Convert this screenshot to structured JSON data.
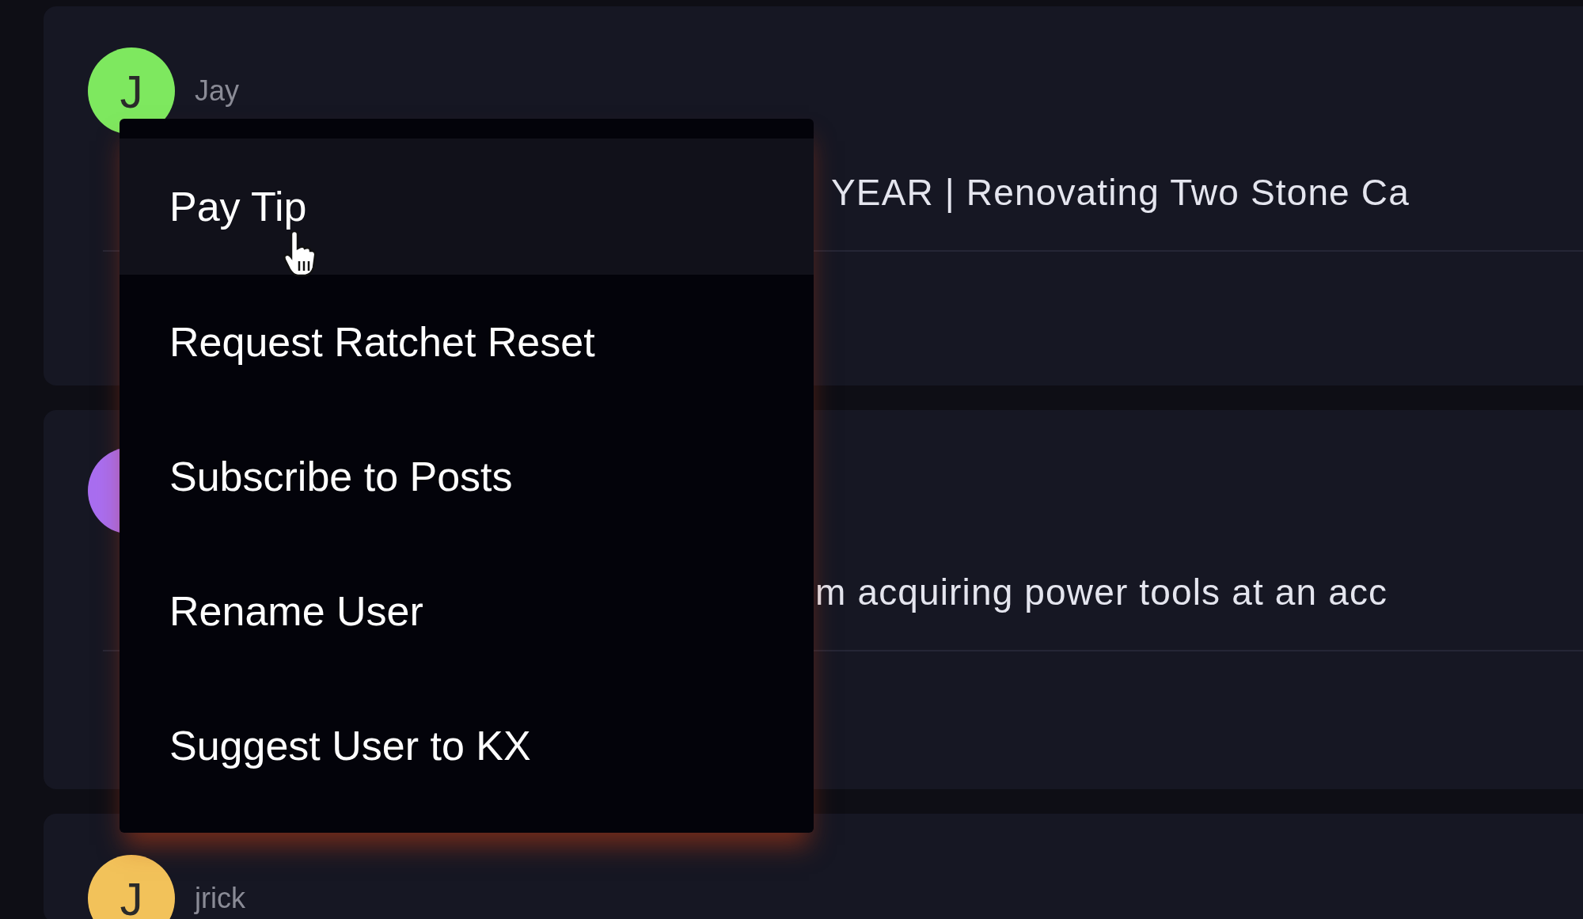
{
  "posts": [
    {
      "author": "Jay",
      "avatar_letter": "J",
      "color": "#7ee85f",
      "text": "YEAR | Renovating Two Stone Ca"
    },
    {
      "color": "#a96ef0",
      "text": "m acquiring power tools at an acc"
    },
    {
      "author": "jrick",
      "avatar_letter": "J",
      "color": "#f2c25a"
    }
  ],
  "context_menu": {
    "items": [
      {
        "label": "Pay Tip",
        "selected": true
      },
      {
        "label": "Request Ratchet Reset",
        "selected": false
      },
      {
        "label": "Subscribe to Posts",
        "selected": false
      },
      {
        "label": "Rename User",
        "selected": false
      },
      {
        "label": "Suggest User to KX",
        "selected": false
      }
    ]
  }
}
